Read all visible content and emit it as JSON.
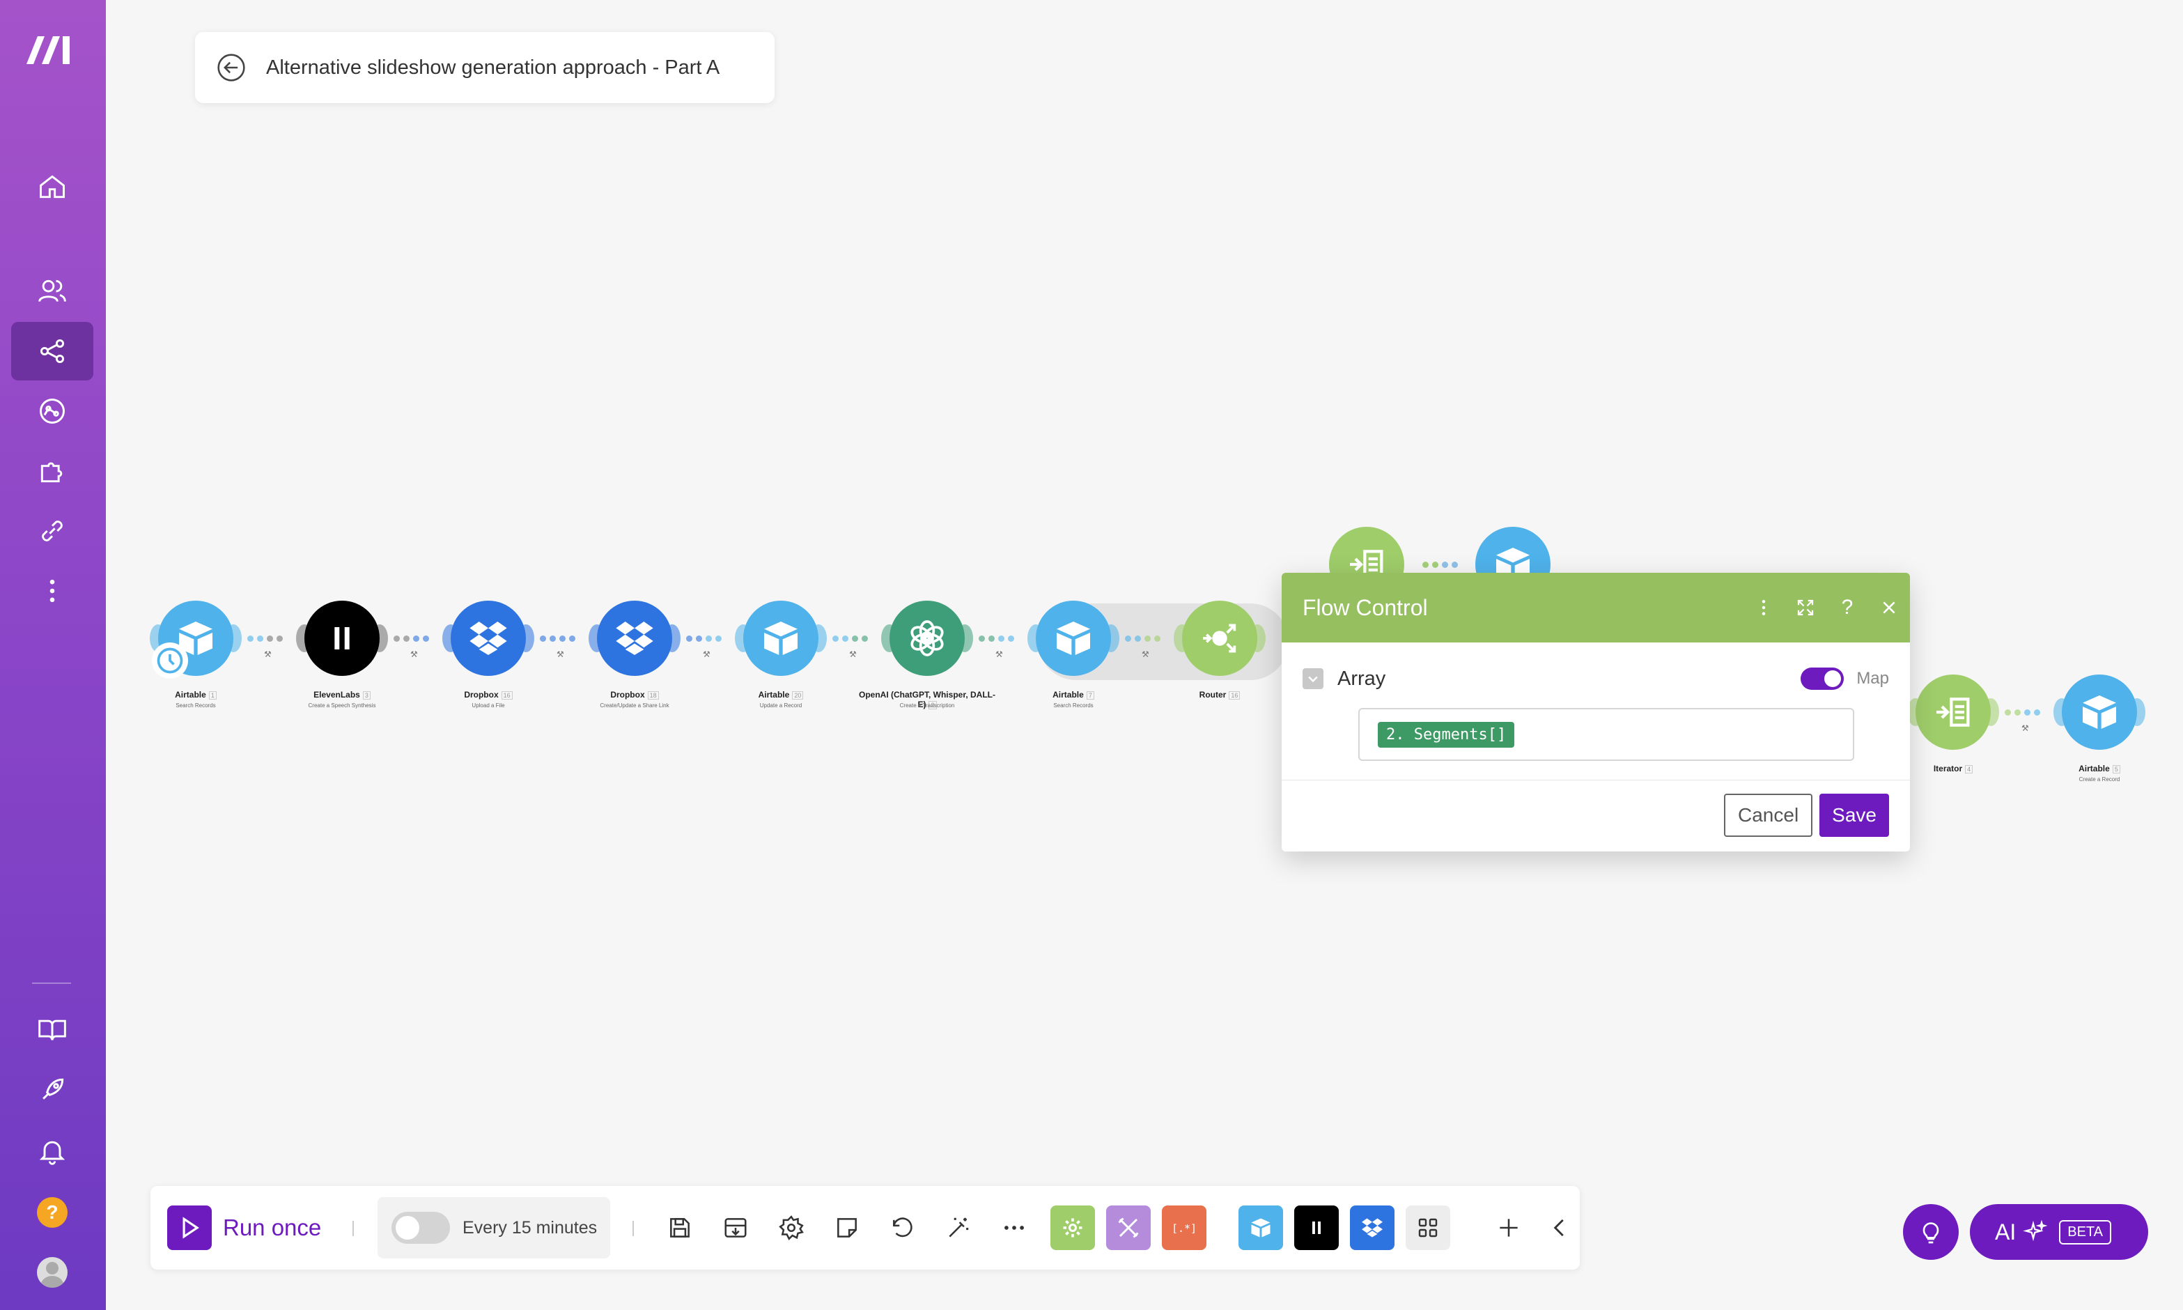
{
  "app": {
    "accent": "#6d1bbf",
    "sidebar_colors": [
      "#a553c9",
      "#6d3ac1"
    ]
  },
  "header": {
    "title": "Alternative slideshow generation approach - Part A"
  },
  "sidebar": {
    "items": [
      {
        "name": "home",
        "icon": "home-icon"
      },
      {
        "name": "team",
        "icon": "users-icon"
      },
      {
        "name": "scenarios",
        "icon": "share-icon",
        "active": true
      },
      {
        "name": "ai",
        "icon": "brain-icon"
      },
      {
        "name": "apps",
        "icon": "puzzle-icon"
      },
      {
        "name": "connections",
        "icon": "link-icon"
      },
      {
        "name": "more",
        "icon": "more-vertical-icon"
      }
    ],
    "bottom_items": [
      {
        "name": "docs",
        "icon": "book-icon"
      },
      {
        "name": "launch",
        "icon": "rocket-icon"
      },
      {
        "name": "notifications",
        "icon": "bell-icon"
      },
      {
        "name": "help",
        "icon": "help-icon",
        "label": "?"
      },
      {
        "name": "profile",
        "icon": "avatar-icon"
      }
    ]
  },
  "modules": [
    {
      "label": "Airtable",
      "index": "1",
      "sub": "Search Records",
      "color": "#4fb2ea",
      "icon": "airtable-icon"
    },
    {
      "label": "ElevenLabs",
      "index": "3",
      "sub": "Create a Speech Synthesis",
      "color": "#000000",
      "icon": "pause-icon"
    },
    {
      "label": "Dropbox",
      "index": "16",
      "sub": "Upload a File",
      "color": "#2e74e0",
      "icon": "dropbox-icon"
    },
    {
      "label": "Dropbox",
      "index": "18",
      "sub": "Create/Update a Share Link",
      "color": "#2e74e0",
      "icon": "dropbox-icon"
    },
    {
      "label": "Airtable",
      "index": "20",
      "sub": "Update a Record",
      "color": "#4fb2ea",
      "icon": "airtable-icon"
    },
    {
      "label": "OpenAI (ChatGPT, Whisper, DALL-E)",
      "index": "2",
      "sub": "Create a Transcription",
      "color": "#3e9e7a",
      "icon": "openai-icon"
    },
    {
      "label": "Airtable",
      "index": "7",
      "sub": "Search Records",
      "color": "#4fb2ea",
      "icon": "airtable-icon"
    },
    {
      "label": "Router",
      "index": "16",
      "sub": "",
      "color": "#9fcd6a",
      "icon": "router-icon"
    },
    {
      "label": "Iterator",
      "index": "4",
      "sub": "",
      "color": "#9fcd6a",
      "icon": "iterator-icon"
    },
    {
      "label": "Airtable",
      "index": "5",
      "sub": "Create a Record",
      "color": "#4fb2ea",
      "icon": "airtable-icon"
    }
  ],
  "panel": {
    "title": "Flow Control",
    "field_label": "Array",
    "map_label": "Map",
    "map_enabled": true,
    "value_pill": "2. Segments[]",
    "cancel_label": "Cancel",
    "save_label": "Save",
    "header_color": "#96bf60"
  },
  "toolbar": {
    "run_label": "Run once",
    "schedule_label": "Every 15 minutes",
    "schedule_enabled": false,
    "tools": [
      "save-icon",
      "import-icon",
      "settings-icon",
      "notes-icon",
      "undo-icon",
      "magic-wand-icon",
      "more-horizontal-icon"
    ],
    "quick_modules": [
      {
        "name": "tools",
        "color": "#9fcd6a",
        "icon": "gear-flower-icon"
      },
      {
        "name": "flow-control",
        "color": "#b58cdc",
        "icon": "cross-tools-icon"
      },
      {
        "name": "text-parser",
        "color": "#e9704d",
        "icon": "bracket-icon",
        "glyph": "[.*]"
      },
      {
        "name": "airtable",
        "color": "#4fb2ea",
        "icon": "airtable-icon"
      },
      {
        "name": "elevenlabs",
        "color": "#000000",
        "icon": "pause-icon"
      },
      {
        "name": "dropbox",
        "color": "#2e74e0",
        "icon": "dropbox-icon"
      },
      {
        "name": "all-apps",
        "color": "#ededed",
        "icon": "grid-icon"
      }
    ]
  },
  "bottom_right": {
    "ai_label": "AI",
    "beta_label": "BETA"
  }
}
